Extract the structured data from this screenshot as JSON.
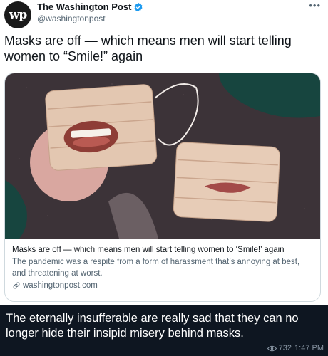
{
  "tweet": {
    "author_name": "The Washington Post",
    "handle": "@washingtonpost",
    "avatar_text": "wp",
    "text": "Masks are off — which means men will start telling women to “Smile!” again",
    "more_icon": "more-horizontal-icon"
  },
  "card": {
    "title": "Masks are off — which means men will start telling women to ‘Smile!’ again",
    "description": "The pandemic was a respite from a form of harassment that’s annoying at best, and threatening at worst.",
    "domain": "washingtonpost.com"
  },
  "message": {
    "caption": "The eternally insufferable are really sad that they can no longer hide their insipid misery behind masks.",
    "views": "732",
    "time": "1:47 PM"
  },
  "colors": {
    "verified": "#1d9bf0",
    "chat_background": "#0e1621",
    "card_background": "#3c3338",
    "accent_teal": "#17453f",
    "accent_pink": "#d9a7a0"
  }
}
